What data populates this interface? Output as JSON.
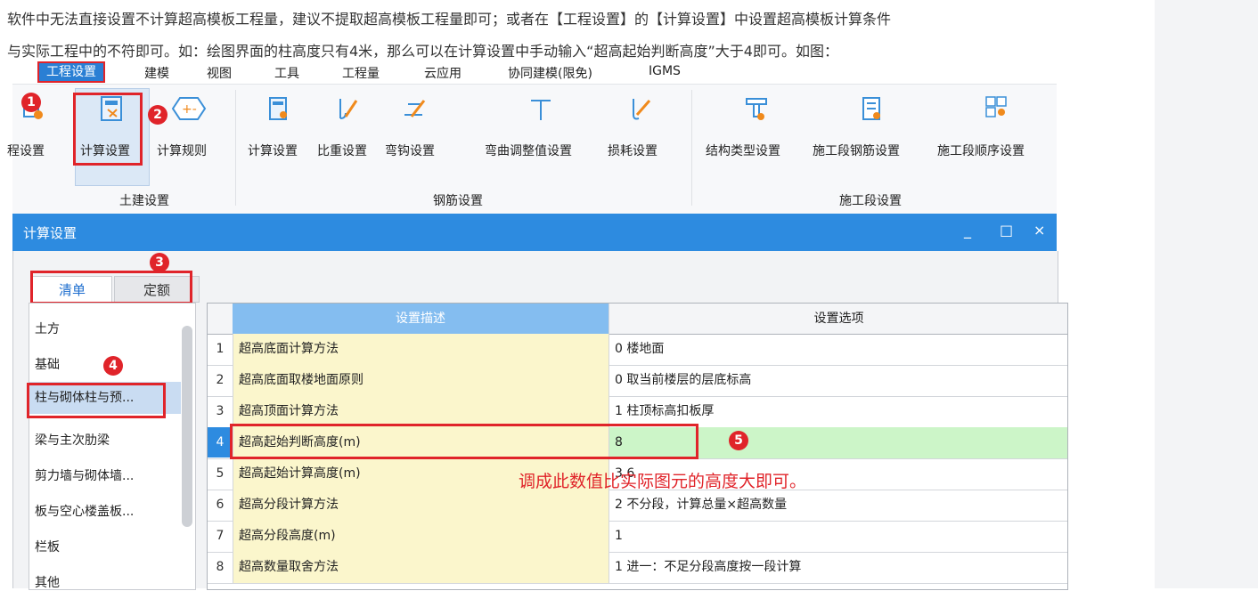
{
  "intro": {
    "line1": "软件中无法直接设置不计算超高模板工程量，建议不提取超高模板工程量即可；或者在【工程设置】的【计算设置】中设置超高模板计算条件",
    "line2": "与实际工程中的不符即可。如：绘图界面的柱高度只有4米，那么可以在计算设置中手动输入“超高起始判断高度”大于4即可。如图："
  },
  "menu": [
    "工程设置",
    "建模",
    "视图",
    "工具",
    "工程量",
    "云应用",
    "协同建模(限免)",
    "IGMS"
  ],
  "ribbon": {
    "partial_label": "程设置",
    "tujian": {
      "btn1": "计算设置",
      "btn2": "计算规则",
      "group": "土建设置"
    },
    "gangjin": {
      "buttons": [
        "计算设置",
        "比重设置",
        "弯钩设置",
        "弯曲调整值设置",
        "损耗设置"
      ],
      "group": "钢筋设置"
    },
    "shigong": {
      "buttons": [
        "结构类型设置",
        "施工段钢筋设置",
        "施工段顺序设置"
      ],
      "group": "施工段设置"
    }
  },
  "dialog": {
    "title": "计算设置",
    "controls": [
      "_",
      "□",
      "×"
    ],
    "tabs": [
      "清单",
      "定额"
    ],
    "categories": [
      "土方",
      "基础",
      "柱与砌体柱与预...",
      "梁与主次肋梁",
      "剪力墙与砌体墙...",
      "板与空心楼盖板...",
      "栏板",
      "其他"
    ],
    "grid": {
      "headers": [
        "设置描述",
        "设置选项"
      ],
      "rows": [
        {
          "n": "1",
          "desc": "超高底面计算方法",
          "opt": "0 楼地面"
        },
        {
          "n": "2",
          "desc": "超高底面取楼地面原则",
          "opt": "0 取当前楼层的层底标高"
        },
        {
          "n": "3",
          "desc": "超高顶面计算方法",
          "opt": "1 柱顶标高扣板厚"
        },
        {
          "n": "4",
          "desc": "超高起始判断高度(m)",
          "opt": "8"
        },
        {
          "n": "5",
          "desc": "超高起始计算高度(m)",
          "opt": "3.6"
        },
        {
          "n": "6",
          "desc": "超高分段计算方法",
          "opt": "2 不分段，计算总量×超高数量"
        },
        {
          "n": "7",
          "desc": "超高分段高度(m)",
          "opt": "1"
        },
        {
          "n": "8",
          "desc": "超高数量取舍方法",
          "opt": "1 进一：不足分段高度按一段计算"
        }
      ]
    }
  },
  "annotation": "调成此数值比实际图元的高度大即可。",
  "badges": [
    "1",
    "2",
    "3",
    "4",
    "5"
  ],
  "colors": {
    "accent": "#2d8be0",
    "annotation_red": "#e0242a",
    "desc_bg": "#fbf6cc",
    "hl_bg": "#ccf5c8"
  }
}
